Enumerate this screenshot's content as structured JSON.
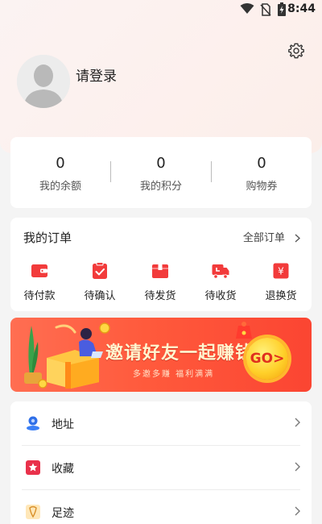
{
  "status_bar": {
    "time": "8:44"
  },
  "profile": {
    "login_text": "请登录"
  },
  "stats": [
    {
      "value": "0",
      "label": "我的余额"
    },
    {
      "value": "0",
      "label": "我的积分"
    },
    {
      "value": "0",
      "label": "购物券"
    }
  ],
  "orders": {
    "title": "我的订单",
    "all_label": "全部订单",
    "items": [
      {
        "label": "待付款",
        "icon": "wallet-icon"
      },
      {
        "label": "待确认",
        "icon": "confirm-icon"
      },
      {
        "label": "待发货",
        "icon": "package-icon"
      },
      {
        "label": "待收货",
        "icon": "truck-icon"
      },
      {
        "label": "退换货",
        "icon": "refund-icon"
      }
    ]
  },
  "banner": {
    "title": "邀请好友一起赚钱",
    "subtitle": "多邀多赚 福利满满",
    "go_label": "GO>"
  },
  "menu": [
    {
      "label": "地址",
      "icon": "location-icon"
    },
    {
      "label": "收藏",
      "icon": "favorite-icon"
    },
    {
      "label": "足迹",
      "icon": "footprint-icon"
    }
  ],
  "colors": {
    "accent": "#f23b3b",
    "background": "#f4f4f4"
  }
}
